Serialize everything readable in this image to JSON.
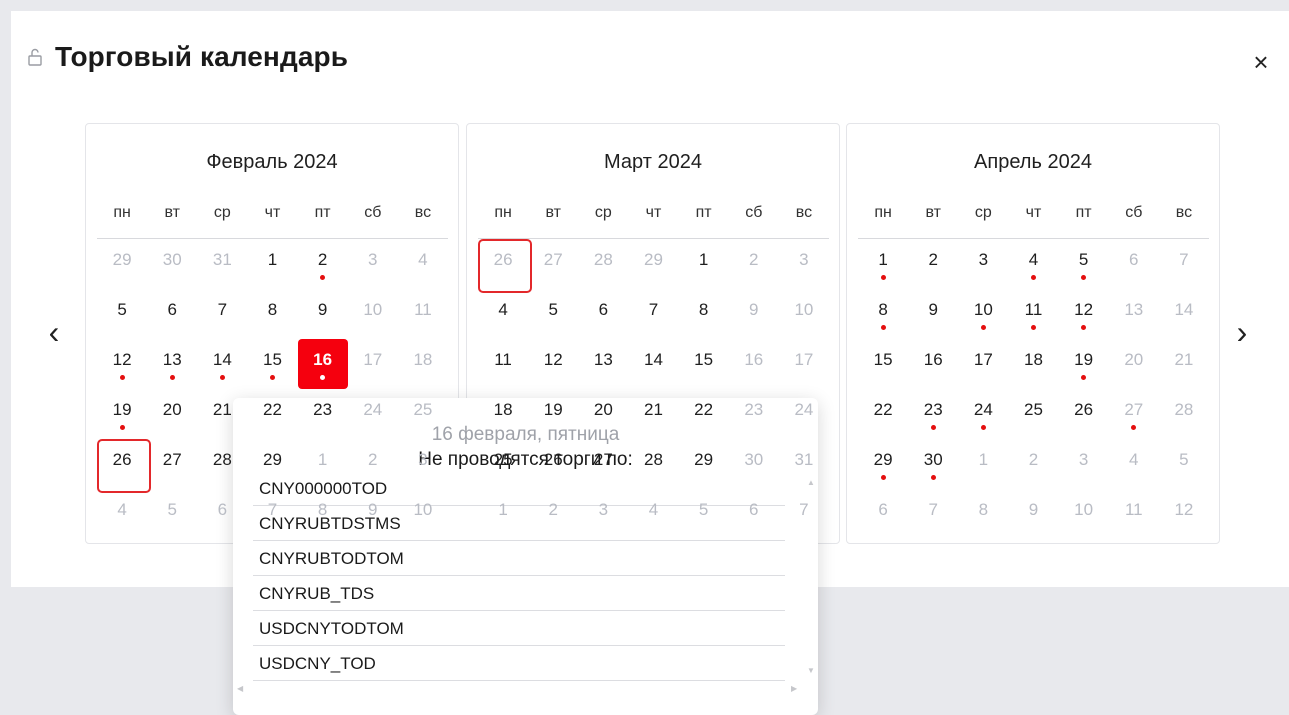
{
  "window": {
    "title": "Торговый календарь"
  },
  "icons": {
    "lock": "lock-icon",
    "close": "close-icon",
    "prev": "chevron-left-icon",
    "next": "chevron-right-icon"
  },
  "colors": {
    "accent": "#f5000e",
    "marker": "#e40f0f",
    "muted": "#b9bcc4"
  },
  "controls": {
    "close_label": "×",
    "prev_label": "‹",
    "next_label": "›"
  },
  "weekdays": [
    "пн",
    "вт",
    "ср",
    "чт",
    "пт",
    "сб",
    "вс"
  ],
  "months": [
    {
      "title": "Февраль 2024",
      "days": [
        {
          "d": "29",
          "out": true
        },
        {
          "d": "30",
          "out": true
        },
        {
          "d": "31",
          "out": true
        },
        {
          "d": "1"
        },
        {
          "d": "2",
          "dot": true
        },
        {
          "d": "3",
          "wknd": true
        },
        {
          "d": "4",
          "wknd": true
        },
        {
          "d": "5"
        },
        {
          "d": "6"
        },
        {
          "d": "7"
        },
        {
          "d": "8"
        },
        {
          "d": "9"
        },
        {
          "d": "10",
          "wknd": true
        },
        {
          "d": "11",
          "wknd": true
        },
        {
          "d": "12",
          "dot": true
        },
        {
          "d": "13",
          "dot": true
        },
        {
          "d": "14",
          "dot": true
        },
        {
          "d": "15",
          "dot": true
        },
        {
          "d": "16",
          "dot": true,
          "selected": true
        },
        {
          "d": "17",
          "wknd": true
        },
        {
          "d": "18",
          "wknd": true
        },
        {
          "d": "19",
          "dot": true
        },
        {
          "d": "20"
        },
        {
          "d": "21"
        },
        {
          "d": "22"
        },
        {
          "d": "23"
        },
        {
          "d": "24",
          "wknd": true
        },
        {
          "d": "25",
          "wknd": true
        },
        {
          "d": "26",
          "today": true
        },
        {
          "d": "27"
        },
        {
          "d": "28"
        },
        {
          "d": "29"
        },
        {
          "d": "1",
          "out": true
        },
        {
          "d": "2",
          "out": true
        },
        {
          "d": "3",
          "out": true
        },
        {
          "d": "4",
          "out": true
        },
        {
          "d": "5",
          "out": true
        },
        {
          "d": "6",
          "out": true
        },
        {
          "d": "7",
          "out": true
        },
        {
          "d": "8",
          "out": true
        },
        {
          "d": "9",
          "out": true
        },
        {
          "d": "10",
          "out": true
        }
      ]
    },
    {
      "title": "Март 2024",
      "days": [
        {
          "d": "26",
          "out": true,
          "today": true
        },
        {
          "d": "27",
          "out": true
        },
        {
          "d": "28",
          "out": true
        },
        {
          "d": "29",
          "out": true
        },
        {
          "d": "1"
        },
        {
          "d": "2",
          "wknd": true
        },
        {
          "d": "3",
          "wknd": true
        },
        {
          "d": "4"
        },
        {
          "d": "5"
        },
        {
          "d": "6"
        },
        {
          "d": "7"
        },
        {
          "d": "8"
        },
        {
          "d": "9",
          "wknd": true
        },
        {
          "d": "10",
          "wknd": true
        },
        {
          "d": "11"
        },
        {
          "d": "12"
        },
        {
          "d": "13"
        },
        {
          "d": "14"
        },
        {
          "d": "15"
        },
        {
          "d": "16",
          "wknd": true
        },
        {
          "d": "17",
          "wknd": true
        },
        {
          "d": "18"
        },
        {
          "d": "19"
        },
        {
          "d": "20"
        },
        {
          "d": "21"
        },
        {
          "d": "22"
        },
        {
          "d": "23",
          "wknd": true
        },
        {
          "d": "24",
          "wknd": true
        },
        {
          "d": "25"
        },
        {
          "d": "26"
        },
        {
          "d": "27"
        },
        {
          "d": "28"
        },
        {
          "d": "29"
        },
        {
          "d": "30",
          "wknd": true
        },
        {
          "d": "31",
          "wknd": true
        },
        {
          "d": "1",
          "out": true
        },
        {
          "d": "2",
          "out": true
        },
        {
          "d": "3",
          "out": true
        },
        {
          "d": "4",
          "out": true
        },
        {
          "d": "5",
          "out": true
        },
        {
          "d": "6",
          "out": true
        },
        {
          "d": "7",
          "out": true
        }
      ]
    },
    {
      "title": "Апрель 2024",
      "days": [
        {
          "d": "1",
          "dot": true
        },
        {
          "d": "2"
        },
        {
          "d": "3"
        },
        {
          "d": "4",
          "dot": true
        },
        {
          "d": "5",
          "dot": true
        },
        {
          "d": "6",
          "wknd": true
        },
        {
          "d": "7",
          "wknd": true
        },
        {
          "d": "8",
          "dot": true
        },
        {
          "d": "9"
        },
        {
          "d": "10",
          "dot": true
        },
        {
          "d": "11",
          "dot": true
        },
        {
          "d": "12",
          "dot": true
        },
        {
          "d": "13",
          "wknd": true
        },
        {
          "d": "14",
          "wknd": true
        },
        {
          "d": "15"
        },
        {
          "d": "16"
        },
        {
          "d": "17"
        },
        {
          "d": "18"
        },
        {
          "d": "19",
          "dot": true
        },
        {
          "d": "20",
          "wknd": true
        },
        {
          "d": "21",
          "wknd": true
        },
        {
          "d": "22"
        },
        {
          "d": "23",
          "dot": true
        },
        {
          "d": "24",
          "dot": true
        },
        {
          "d": "25"
        },
        {
          "d": "26"
        },
        {
          "d": "27",
          "wknd": true,
          "dot": true
        },
        {
          "d": "28",
          "wknd": true
        },
        {
          "d": "29",
          "dot": true
        },
        {
          "d": "30",
          "dot": true
        },
        {
          "d": "1",
          "out": true
        },
        {
          "d": "2",
          "out": true
        },
        {
          "d": "3",
          "out": true
        },
        {
          "d": "4",
          "out": true
        },
        {
          "d": "5",
          "out": true
        },
        {
          "d": "6",
          "out": true
        },
        {
          "d": "7",
          "out": true
        },
        {
          "d": "8",
          "out": true
        },
        {
          "d": "9",
          "out": true
        },
        {
          "d": "10",
          "out": true
        },
        {
          "d": "11",
          "out": true
        },
        {
          "d": "12",
          "out": true
        }
      ]
    }
  ],
  "popup": {
    "date": "16 февраля, пятница",
    "subtitle": "Не проводятся торги по:",
    "items": [
      "CNY000000TOD",
      "CNYRUBTDSTMS",
      "CNYRUBTODTOM",
      "CNYRUB_TDS",
      "USDCNYTODTOM",
      "USDCNY_TOD"
    ]
  }
}
